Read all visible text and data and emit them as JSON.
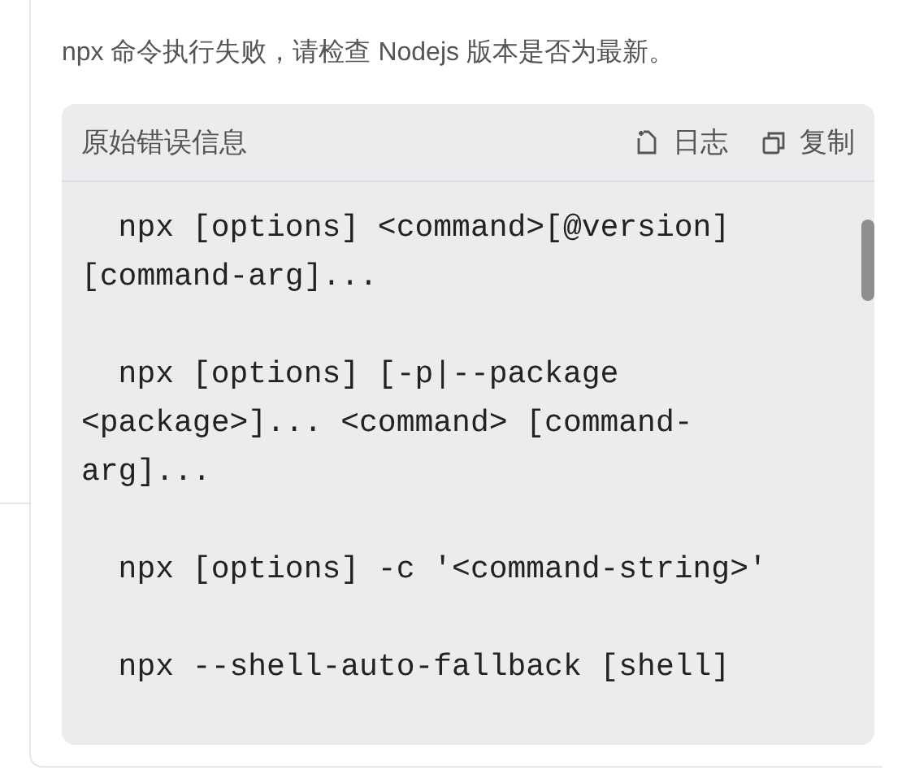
{
  "message": "npx 命令执行失败，请检查 Nodejs 版本是否为最新。",
  "error_panel": {
    "title": "原始错误信息",
    "actions": [
      {
        "kind": "log",
        "label": "日志"
      },
      {
        "kind": "copy",
        "label": "复制"
      }
    ],
    "code_blocks": [
      {
        "lines": [
          "  npx [options] <command>[@version]",
          "[command-arg]..."
        ]
      },
      {
        "lines": [
          "  npx [options] [-p|--package",
          "<package>]... <command> [command-",
          "arg]..."
        ]
      },
      {
        "lines": [
          "  npx [options] -c '<command-string>'"
        ]
      },
      {
        "lines": [
          "  npx --shell-auto-fallback [shell]"
        ]
      }
    ]
  }
}
